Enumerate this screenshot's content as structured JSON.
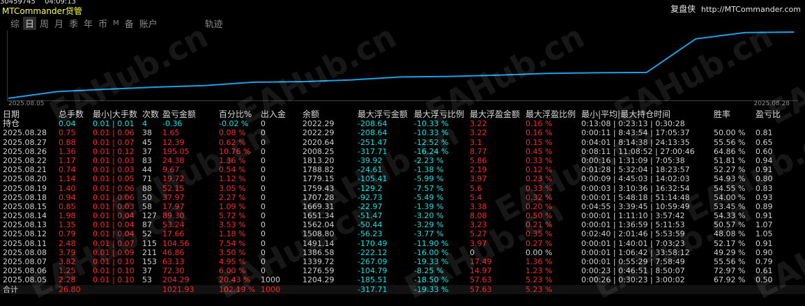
{
  "header": {
    "price": "30459745",
    "time": "04:09:13",
    "app_name": "MTCommander贷管",
    "brand": "复盘侠",
    "url": "http://MTCommander.com"
  },
  "tabs": [
    {
      "label": "综"
    },
    {
      "label": "日"
    },
    {
      "label": "周"
    },
    {
      "label": "月"
    },
    {
      "label": "季"
    },
    {
      "label": "年"
    },
    {
      "label": "币"
    },
    {
      "label": "M"
    },
    {
      "label": "备"
    },
    {
      "label": "账户"
    },
    {
      "label": "轨迹"
    }
  ],
  "colors": {
    "curve": "#1ea0e8",
    "positive": "#00e5e5",
    "negative": "#ff2222"
  },
  "chart_data": {
    "type": "line",
    "x": [
      "2025.08.05",
      "2025.08.06",
      "2025.08.07",
      "2025.08.08",
      "2025.08.11",
      "2025.08.12",
      "2025.08.13",
      "2025.08.14",
      "2025.08.15",
      "2025.08.18",
      "2025.08.19",
      "2025.08.20",
      "2025.08.21",
      "2025.08.22",
      "2025.08.26",
      "2025.08.27",
      "2025.08.28"
    ],
    "y": [
      0,
      204.29,
      276.59,
      339.72,
      386.58,
      491.14,
      508.8,
      562.04,
      651.34,
      669.31,
      707.28,
      759.43,
      779.15,
      788.82,
      1813.2,
      2008.25,
      2022.29
    ],
    "date_start": "2025.08.05",
    "date_end": "2025.08.28"
  },
  "table": {
    "headers": [
      "日期",
      "总手数",
      "最小|大手数",
      "次数",
      "盈亏金额",
      "百分比%",
      "出入金",
      "余额",
      "最大浮亏金额",
      "最大浮亏比例",
      "最大浮盈金额",
      "最大浮盈比例",
      "最小|平均|最大持仓时间",
      "胜率",
      "盈亏比"
    ],
    "holding": {
      "label": "持仓",
      "cells": [
        "0.04",
        "0.01 | 0.01",
        "4",
        "-0.36",
        "-0.02 %",
        "0",
        "2022.29",
        "-208.64",
        "-10.33 %",
        "3.22",
        "0.16 %",
        "0:13:08 | 0:23:13 | 0:30:28"
      ]
    },
    "rows": [
      [
        "2025.08.28",
        "0.75",
        "0.01 | 0.06",
        "38",
        "1.65",
        "0.08 %",
        "0",
        "2022.29",
        "-208.64",
        "-10.33 %",
        "3.22",
        "0.16 %",
        "0:00:11 | 8:43:54 | 17:05:37",
        "50.00 %",
        "0.81"
      ],
      [
        "2025.08.27",
        "0.88",
        "0.01 | 0.07",
        "45",
        "12.39",
        "0.62 %",
        "0",
        "2020.64",
        "-251.47",
        "-12.52 %",
        "3.1",
        "0.15 %",
        "0:04:01 | 8:14:38 | 24:13:35",
        "55.56 %",
        "0.65"
      ],
      [
        "2025.08.26",
        "1.36",
        "0.01 | 0.12",
        "37",
        "195.05",
        "10.76 %",
        "0",
        "2008.25",
        "-317.71",
        "-16.24 %",
        "8.77",
        "0.45 %",
        "0:08:11 | 11:08:52 | 27:00:46",
        "64.86 %",
        "0.60"
      ],
      [
        "2025.08.22",
        "1.17",
        "0.01 | 0.03",
        "83",
        "24.38",
        "1.36 %",
        "0",
        "1813.20",
        "-39.92",
        "-2.23 %",
        "5.86",
        "0.33 %",
        "0:00:16 | 1:31:09 | 7:05:38",
        "51.81 %",
        "0.94"
      ],
      [
        "2025.08.21",
        "0.74",
        "0.01 | 0.03",
        "44",
        "9.67",
        "0.54 %",
        "0",
        "1788.82",
        "-24.61",
        "-1.38 %",
        "2.19",
        "0.12 %",
        "0:01:28 | 5:32:04 | 18:23:57",
        "52.27 %",
        "0.91"
      ],
      [
        "2025.08.20",
        "1.14",
        "0.01 | 0.05",
        "71",
        "19.72",
        "1.12 %",
        "0",
        "1779.15",
        "-105.41",
        "-5.99 %",
        "3.97",
        "0.23 %",
        "0:00:09 | 4:45:03 | 14:02:03",
        "54.93 %",
        "0.80"
      ],
      [
        "2025.08.19",
        "1.40",
        "0.01 | 0.06",
        "88",
        "52.15",
        "3.05 %",
        "0",
        "1759.43",
        "-129.2",
        "-7.57 %",
        "5.6",
        "0.33 %",
        "0:00:03 | 3:10:36 | 16:32:54",
        "54.55 %",
        "0.83"
      ],
      [
        "2025.08.18",
        "0.94",
        "0.01 | 0.06",
        "50",
        "37.97",
        "2.27 %",
        "0",
        "1707.28",
        "-92.73",
        "-5.49 %",
        "5.4",
        "0.32 %",
        "0:00:01 | 5:48:18 | 51:14:48",
        "54.00 %",
        "0.93"
      ],
      [
        "2025.08.15",
        "0.85",
        "0.01 | 0.03",
        "58",
        "17.97",
        "1.09 %",
        "0",
        "1669.31",
        "-22.97",
        "-1.39 %",
        "3.38",
        "0.20 %",
        "0:04:55 | 3:39:45 | 10:59:49",
        "53.45 %",
        "0.89"
      ],
      [
        "2025.08.14",
        "1.98",
        "0.01 | 0.04",
        "127",
        "89.30",
        "5.72 %",
        "0",
        "1651.34",
        "-51.47",
        "-3.20 %",
        "8.08",
        "0.50 %",
        "0:00:01 | 1:11:10 | 3:57:42",
        "54.33 %",
        "0.91"
      ],
      [
        "2025.08.13",
        "1.35",
        "0.01 | 0.04",
        "87",
        "53.24",
        "3.53 %",
        "0",
        "1562.04",
        "-50.44",
        "-3.29 %",
        "3.23",
        "0.21 %",
        "0:00:01 | 1:36:59 | 5:11:53",
        "50.57 %",
        "1.07"
      ],
      [
        "2025.08.12",
        "0.79",
        "0.01 | 0.04",
        "52",
        "17.66",
        "1.18 %",
        "0",
        "1508.80",
        "-56.23",
        "-3.77 %",
        "5.27",
        "0.35 %",
        "0:02:40 | 2:01:46 | 5:53:59",
        "48.08 %",
        "1.05"
      ],
      [
        "2025.08.11",
        "2.48",
        "0.01 | 0.07",
        "115",
        "104.56",
        "7.54 %",
        "0",
        "1491.14",
        "-170.49",
        "-11.90 %",
        "3.97",
        "0.27 %",
        "0:00:01 | 1:40:01 | 7:03:23",
        "52.17 %",
        "0.91"
      ],
      [
        "2025.08.08",
        "3.79",
        "0.01 | 0.09",
        "211",
        "46.86",
        "3.50 %",
        "0",
        "1386.58",
        "-222.12",
        "-16.00 %",
        "0",
        "0.00 %",
        "0:00:01 | 1:06:42 | 33:58:12",
        "49.29 %",
        "0.90"
      ],
      [
        "2025.08.07",
        "3.82",
        "0.01 | 0.10",
        "153",
        "63.13",
        "4.95 %",
        "0",
        "1339.72",
        "-267.09",
        "-19.33 %",
        "17.49",
        "1.36 %",
        "0:00:01 | 0:55:29 | 7:58:49",
        "55.56 %",
        "0.79"
      ],
      [
        "2025.08.06",
        "1.25",
        "0.01 | 0.10",
        "37",
        "72.30",
        "6.00 %",
        "0",
        "1276.59",
        "-104.79",
        "-8.25 %",
        "14.97",
        "1.23 %",
        "0:00:23 | 0:46:51 | 8:50:07",
        "72.97 %",
        "0.61"
      ],
      [
        "2025.08.05",
        "2.28",
        "0.01 | 0.10",
        "53",
        "204.29",
        "20.43 %",
        "1000",
        "1204.29",
        "-185.51",
        "-18.50 %",
        "57.63",
        "5.23 %",
        "0:00:26 | 0:30:23 | 3:00:02",
        "67.92 %",
        "0.50"
      ]
    ],
    "total": {
      "label": "合计",
      "cells": [
        "26.80",
        "",
        "",
        "1021.93",
        "102.19 %",
        "1000",
        "",
        "-317.71",
        "-19.33 %",
        "57.63",
        "5.23 %"
      ]
    }
  },
  "watermark_text": "EAHub.cn"
}
